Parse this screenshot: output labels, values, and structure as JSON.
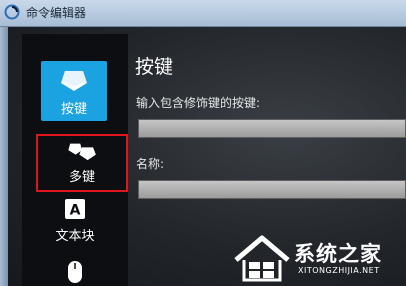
{
  "window": {
    "title": "命令编辑器"
  },
  "sidebar": {
    "items": [
      {
        "label": "按键",
        "icon": "keycap-icon",
        "selected": true
      },
      {
        "label": "多键",
        "icon": "multi-keys-icon",
        "highlighted": true
      },
      {
        "label": "文本块",
        "icon": "text-block-icon"
      },
      {
        "label": "",
        "icon": "mouse-icon"
      }
    ]
  },
  "content": {
    "title": "按键",
    "fields": [
      {
        "label": "输入包含修饰键的按键:",
        "value": ""
      },
      {
        "label": "名称:",
        "value": ""
      }
    ]
  },
  "watermark": {
    "text": "系统之家",
    "url": "XITONGZHIJIA.NET"
  },
  "colors": {
    "selected_bg": "#1aa3e0",
    "highlight_border": "#e0141b",
    "sidebar_bg": "#0c0e11",
    "field_bg": "#b8b8b8"
  }
}
